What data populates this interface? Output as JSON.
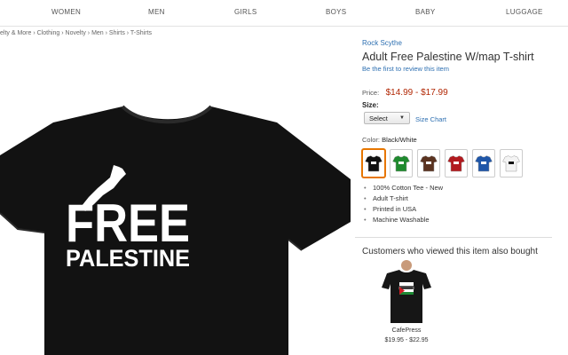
{
  "nav": {
    "items": [
      "WOMEN",
      "MEN",
      "GIRLS",
      "BOYS",
      "BABY",
      "LUGGAGE"
    ]
  },
  "breadcrumb": "elty & More › Clothing › Novelty › Men › Shirts › T-Shirts",
  "product": {
    "shirt_text_line1": "FREE",
    "shirt_text_line2": "PALESTINE",
    "brand": "Rock Scythe",
    "title": "Adult Free Palestine W/map T-shirt",
    "review_link": "Be the first to review this item",
    "price_label": "Price:",
    "price": "$14.99 - $17.99",
    "size_label": "Size:",
    "size_selected": "Select",
    "size_chart_link": "Size Chart",
    "color_label": "Color:",
    "color_selected": "Black/White",
    "swatches": [
      {
        "name": "Black/White",
        "color": "#111111",
        "selected": true
      },
      {
        "name": "Green",
        "color": "#1f8a2e"
      },
      {
        "name": "Brown",
        "color": "#5a3320"
      },
      {
        "name": "Red",
        "color": "#b21a1f"
      },
      {
        "name": "Blue",
        "color": "#1f56a8"
      },
      {
        "name": "White",
        "color": "#f4f4f4"
      }
    ],
    "features": [
      "100% Cotton Tee - New",
      "Adult T-shirt",
      "Printed in USA",
      "Machine Washable"
    ]
  },
  "also_bought": {
    "heading": "Customers who viewed this item also bought",
    "items": [
      {
        "brand": "CafePress",
        "price": "$19.95 - $22.95"
      }
    ]
  },
  "colors": {
    "link": "#2d6fb1",
    "price": "#b12704",
    "swatch_selected_border": "#e77600"
  }
}
